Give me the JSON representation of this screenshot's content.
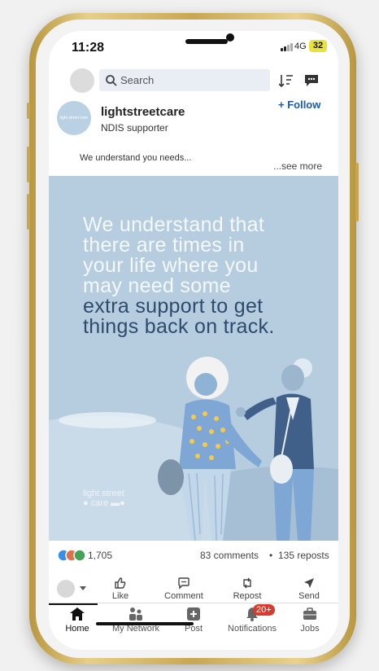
{
  "status": {
    "time": "11:28",
    "network": "4G",
    "battery": "32"
  },
  "topbar": {
    "search_placeholder": "Search"
  },
  "post": {
    "author": "lightstreetcare",
    "subtitle": "NDIS supporter",
    "follow_label": "+ Follow",
    "caption": "We understand you needs...",
    "see_more": "...see more",
    "logo_text": "light street care",
    "hero_lines_light": [
      "We understand that",
      "there are times in",
      "your life where you",
      "may need some"
    ],
    "hero_lines_dark": [
      "extra support to get",
      "things back on track."
    ],
    "brand_line1": "light street",
    "brand_line2": "care"
  },
  "stats": {
    "reactions": "1,705",
    "comments": "83 comments",
    "separator": "•",
    "reposts": "135 reposts"
  },
  "actions": [
    {
      "label": "Like",
      "icon": "thumbs-up-icon"
    },
    {
      "label": "Comment",
      "icon": "comment-icon"
    },
    {
      "label": "Repost",
      "icon": "repost-icon"
    },
    {
      "label": "Send",
      "icon": "send-icon"
    }
  ],
  "nav": [
    {
      "label": "Home",
      "icon": "home-icon"
    },
    {
      "label": "My Network",
      "icon": "network-icon"
    },
    {
      "label": "Post",
      "icon": "post-icon"
    },
    {
      "label": "Notifications",
      "icon": "bell-icon",
      "badge": "20+"
    },
    {
      "label": "Jobs",
      "icon": "briefcase-icon"
    }
  ],
  "colors": {
    "accent": "#1e5ba8",
    "hero_bg": "#b6cde0",
    "badge": "#d93a2b",
    "frame": "#c8a752"
  }
}
